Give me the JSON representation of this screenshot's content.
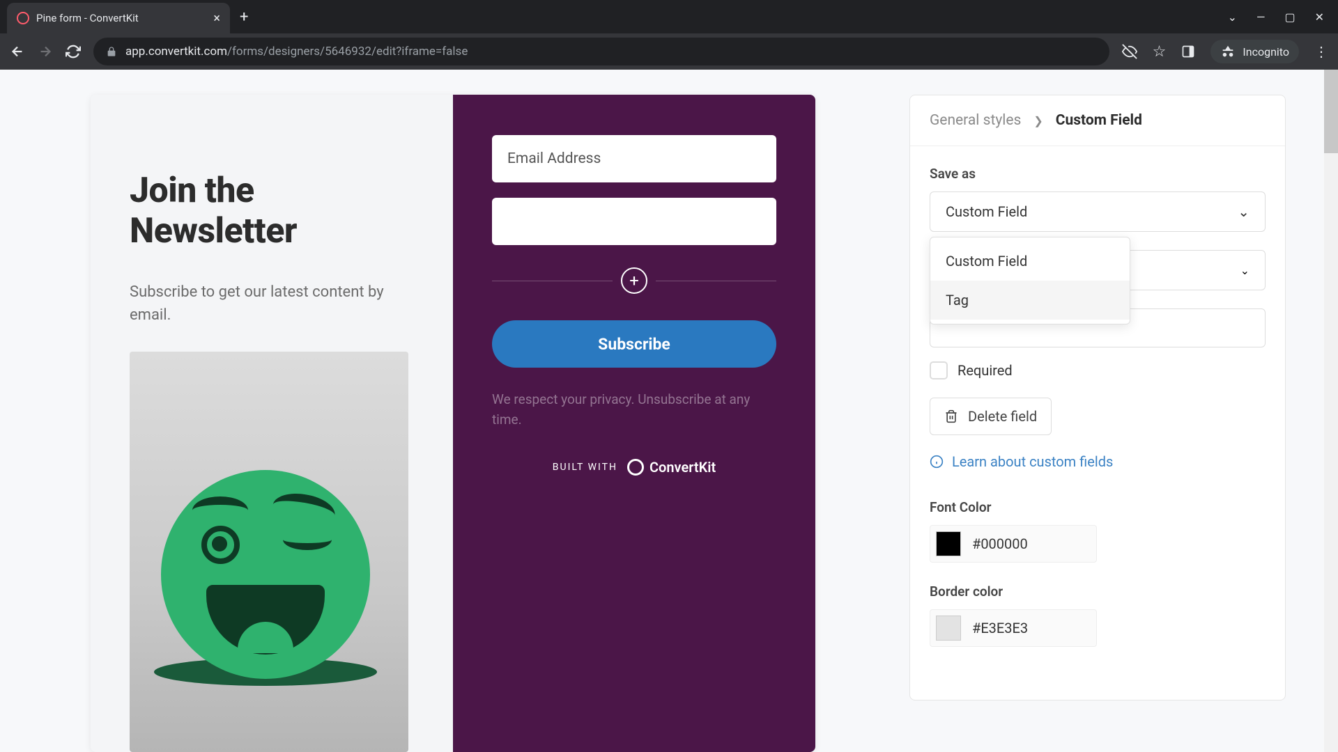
{
  "browser": {
    "tab_title": "Pine form - ConvertKit",
    "url_host": "app.convertkit.com",
    "url_path": "/forms/designers/5646932/edit?iframe=false",
    "incognito_label": "Incognito"
  },
  "form": {
    "heading": "Join the Newsletter",
    "subheading": "Subscribe to get our latest content by email.",
    "email_placeholder": "Email Address",
    "subscribe_label": "Subscribe",
    "privacy_text": "We respect your privacy. Unsubscribe at any time.",
    "built_with": "BUILT WITH",
    "brand": "ConvertKit"
  },
  "settings": {
    "breadcrumb_parent": "General styles",
    "breadcrumb_current": "Custom Field",
    "save_as_label": "Save as",
    "save_as_value": "Custom Field",
    "dropdown_options": [
      "Custom Field",
      "Tag"
    ],
    "required_label": "Required",
    "delete_label": "Delete field",
    "learn_link": "Learn about custom fields",
    "font_color_label": "Font Color",
    "font_color_value": "#000000",
    "border_color_label": "Border color",
    "border_color_value": "#E3E3E3"
  }
}
